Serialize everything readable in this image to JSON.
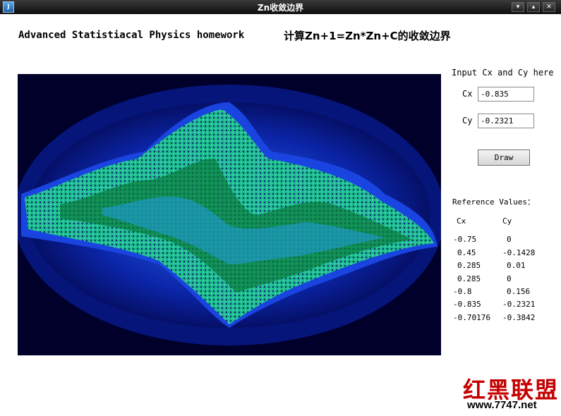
{
  "window": {
    "title": "Zn收敛边界",
    "controls": [
      "▾",
      "▴",
      "✕"
    ]
  },
  "header": {
    "english": "Advanced Statistiacal Physics homework",
    "chinese": "计算Zn+1=Zn*Zn+C的收敛边界"
  },
  "panel": {
    "prompt": "Input Cx and Cy here",
    "cx_label": "Cx",
    "cx_value": "-0.835",
    "cy_label": "Cy",
    "cy_value": "-0.2321",
    "draw_label": "Draw"
  },
  "reference": {
    "title": "Reference Values：",
    "col_cx": "Cx",
    "col_cy": "Cy",
    "rows": [
      {
        "cx": "-0.75",
        "cy": "0"
      },
      {
        "cx": "0.45",
        "cy": "-0.1428"
      },
      {
        "cx": "0.285",
        "cy": "0.01"
      },
      {
        "cx": "0.285",
        "cy": "0"
      },
      {
        "cx": "-0.8",
        "cy": "0.156"
      },
      {
        "cx": "-0.835",
        "cy": "-0.2321"
      },
      {
        "cx": "-0.70176",
        "cy": "-0.3842"
      }
    ]
  },
  "watermark": {
    "brand": "红黑联盟",
    "url": "www.7747.net"
  }
}
